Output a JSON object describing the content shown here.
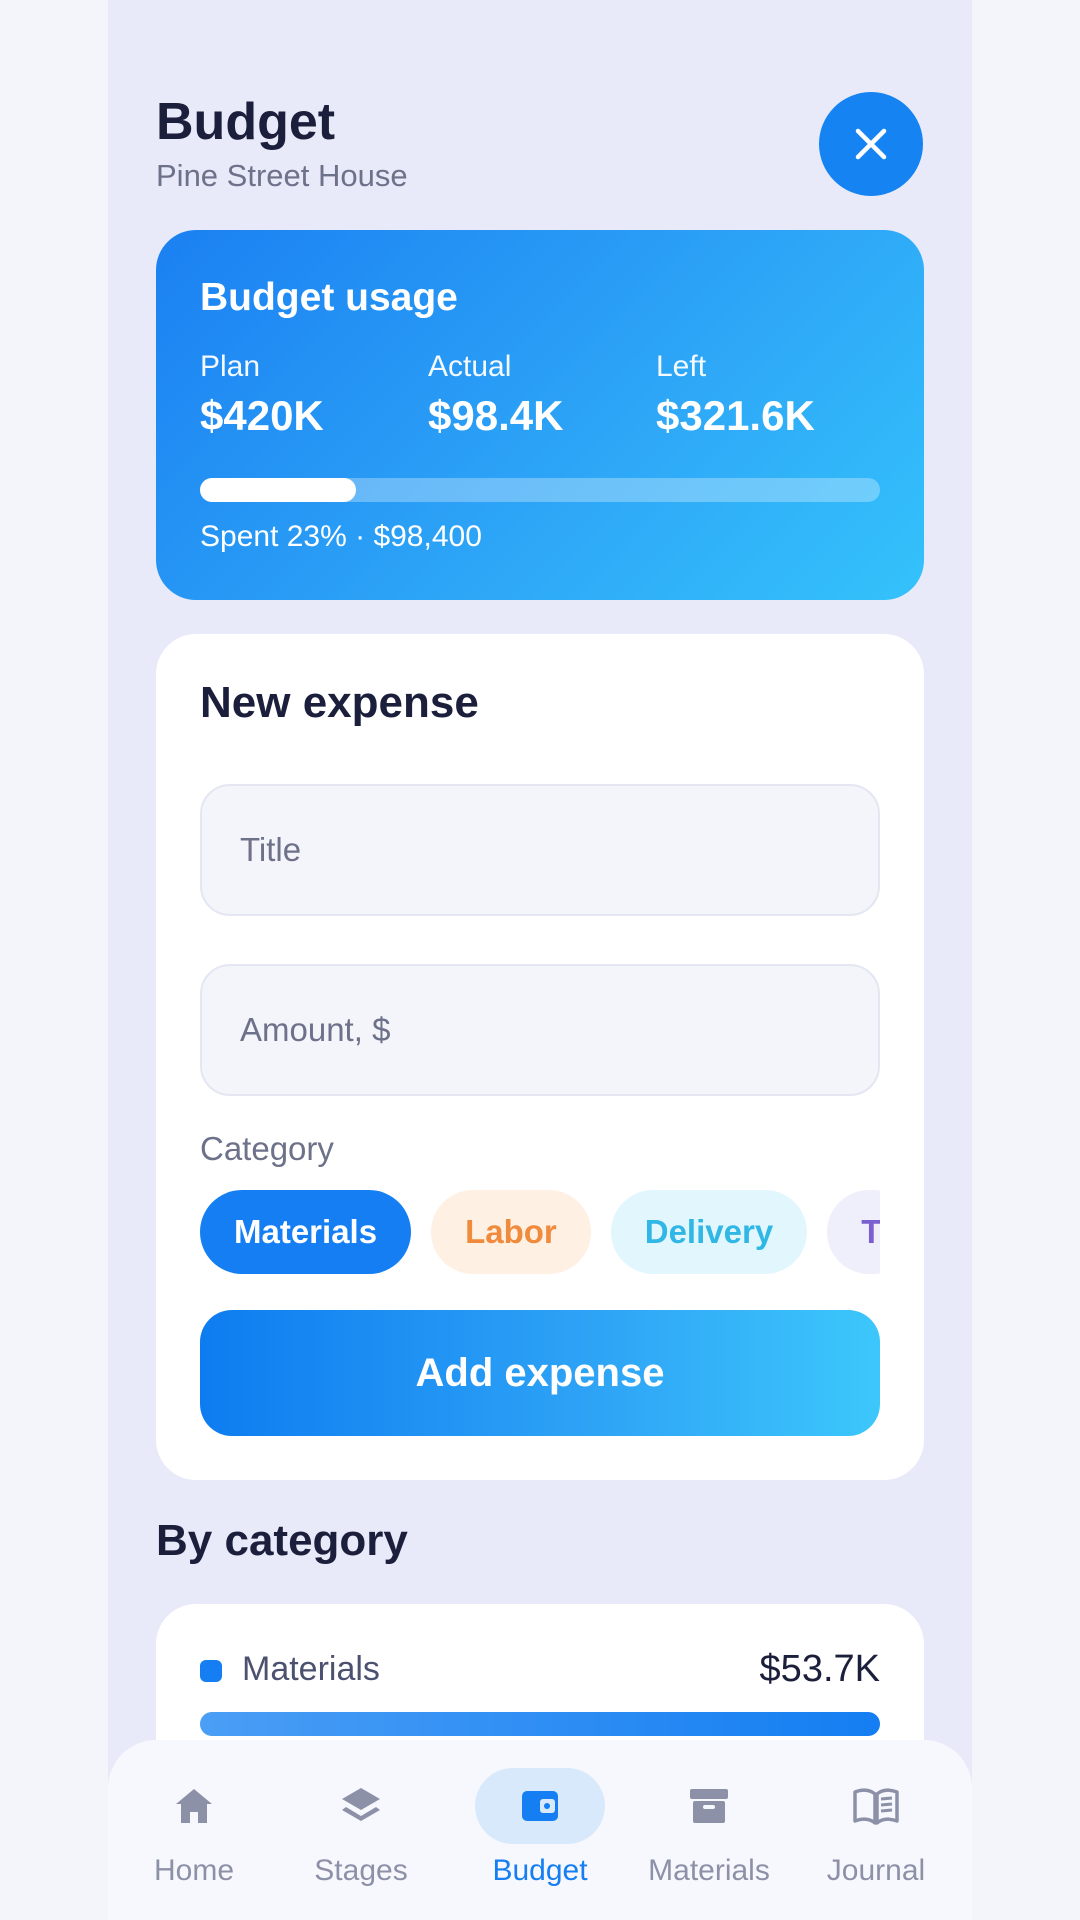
{
  "header": {
    "title": "Budget",
    "subtitle": "Pine Street House"
  },
  "usage": {
    "title": "Budget usage",
    "plan_label": "Plan",
    "plan_value": "$420K",
    "actual_label": "Actual",
    "actual_value": "$98.4K",
    "left_label": "Left",
    "left_value": "$321.6K",
    "spent_fraction": 0.23,
    "spent_text": "Spent 23% · $98,400"
  },
  "expense_form": {
    "title": "New expense",
    "title_placeholder": "Title",
    "amount_placeholder": "Amount, $",
    "category_label": "Category",
    "chips": [
      {
        "label": "Materials",
        "selected": true
      },
      {
        "label": "Labor",
        "selected": false
      },
      {
        "label": "Delivery",
        "selected": false
      },
      {
        "label": "T",
        "selected": false
      }
    ],
    "submit_label": "Add expense"
  },
  "by_category": {
    "title": "By category",
    "items": [
      {
        "name": "Materials",
        "amount": "$53.7K",
        "fraction": 1.0
      }
    ]
  },
  "nav": {
    "items": [
      {
        "label": "Home",
        "icon": "home-icon",
        "active": false
      },
      {
        "label": "Stages",
        "icon": "layers-icon",
        "active": false
      },
      {
        "label": "Budget",
        "icon": "wallet-icon",
        "active": true
      },
      {
        "label": "Materials",
        "icon": "archive-box-icon",
        "active": false
      },
      {
        "label": "Journal",
        "icon": "book-icon",
        "active": false
      }
    ]
  },
  "colors": {
    "accent": "#147ef2",
    "background": "#e8e9f9"
  }
}
